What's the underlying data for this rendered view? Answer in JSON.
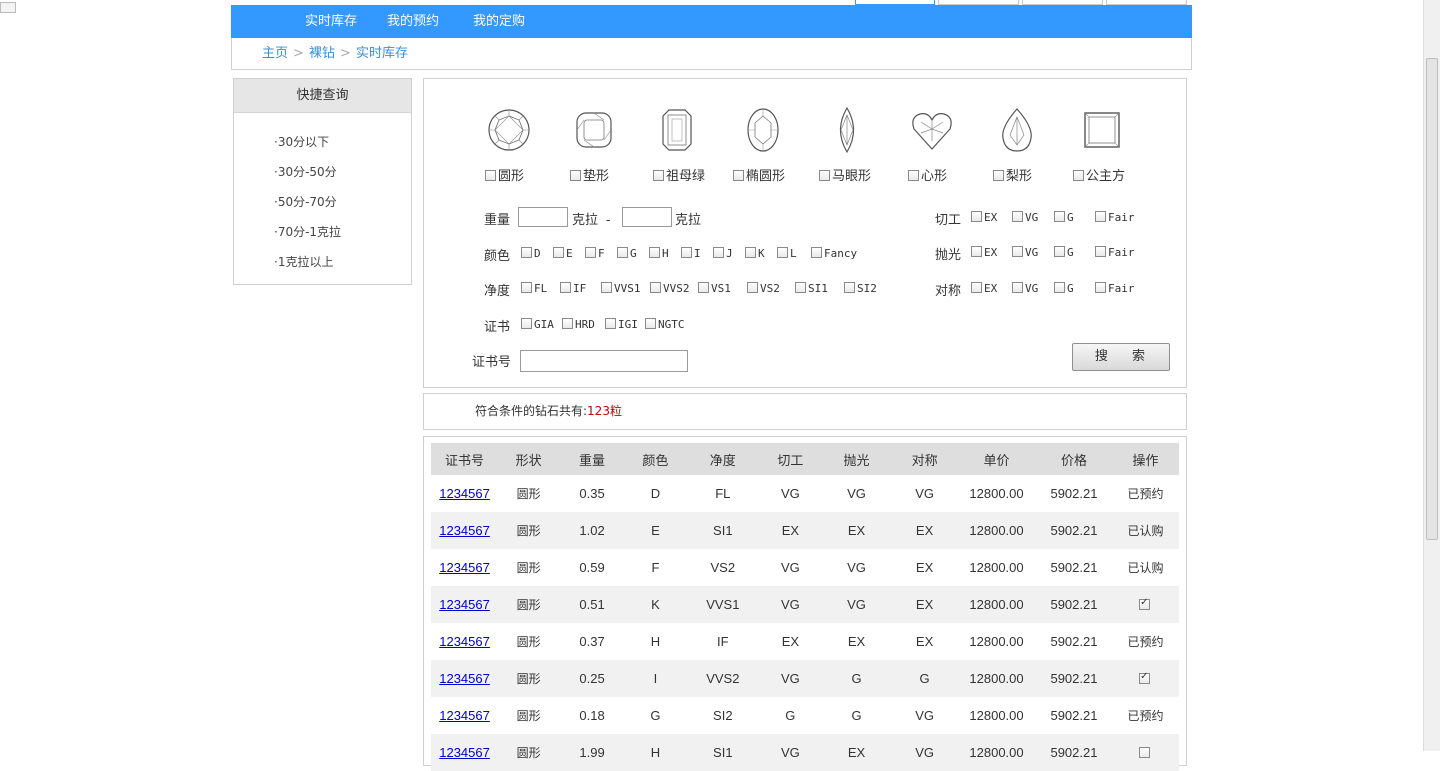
{
  "nav": {
    "tabs": [
      "实时库存",
      "我的预约",
      "我的定购"
    ]
  },
  "breadcrumb": [
    "主页",
    "裸钻",
    "实时库存"
  ],
  "sidebar": {
    "title": "快捷查询",
    "items": [
      "·30分以下",
      "·30分-50分",
      "·50分-70分",
      "·70分-1克拉",
      "·1克拉以上"
    ]
  },
  "shapes": [
    "圆形",
    "垫形",
    "祖母绿",
    "椭圆形",
    "马眼形",
    "心形",
    "梨形",
    "公主方"
  ],
  "filters": {
    "weight_label": "重量",
    "unit": "克拉",
    "dash": "-",
    "color_label": "颜色",
    "color_options": [
      "D",
      "E",
      "F",
      "G",
      "H",
      "I",
      "J",
      "K",
      "L",
      "Fancy"
    ],
    "clarity_label": "净度",
    "clarity_options": [
      "FL",
      "IF",
      "VVS1",
      "VVS2",
      "VS1",
      "VS2",
      "SI1",
      "SI2"
    ],
    "cert_label": "证书",
    "cert_options": [
      "GIA",
      "HRD",
      "IGI",
      "NGTC"
    ],
    "cert_no_label": "证书号",
    "cut_label": "切工",
    "polish_label": "抛光",
    "symmetry_label": "对称",
    "grade_options": [
      "EX",
      "VG",
      "G",
      "Fair"
    ],
    "search_label": "搜 索"
  },
  "count": {
    "prefix": "符合条件的钻石共有:",
    "value": "123粒"
  },
  "table": {
    "headers": [
      "证书号",
      "形状",
      "重量",
      "颜色",
      "净度",
      "切工",
      "抛光",
      "对称",
      "单价",
      "价格",
      "操作"
    ],
    "rows": [
      [
        "1234567",
        "圆形",
        "0.35",
        "D",
        "FL",
        "VG",
        "VG",
        "VG",
        "12800.00",
        "5902.21",
        "已预约"
      ],
      [
        "1234567",
        "圆形",
        "1.02",
        "E",
        "SI1",
        "EX",
        "EX",
        "EX",
        "12800.00",
        "5902.21",
        "已认购"
      ],
      [
        "1234567",
        "圆形",
        "0.59",
        "F",
        "VS2",
        "VG",
        "VG",
        "EX",
        "12800.00",
        "5902.21",
        "已认购"
      ],
      [
        "1234567",
        "圆形",
        "0.51",
        "K",
        "VVS1",
        "VG",
        "VG",
        "EX",
        "12800.00",
        "5902.21",
        "checked"
      ],
      [
        "1234567",
        "圆形",
        "0.37",
        "H",
        "IF",
        "EX",
        "EX",
        "EX",
        "12800.00",
        "5902.21",
        "已预约"
      ],
      [
        "1234567",
        "圆形",
        "0.25",
        "I",
        "VVS2",
        "VG",
        "G",
        "G",
        "12800.00",
        "5902.21",
        "checked"
      ],
      [
        "1234567",
        "圆形",
        "0.18",
        "G",
        "SI2",
        "G",
        "G",
        "VG",
        "12800.00",
        "5902.21",
        "已预约"
      ],
      [
        "1234567",
        "圆形",
        "1.99",
        "H",
        "SI1",
        "VG",
        "EX",
        "VG",
        "12800.00",
        "5902.21",
        "unchecked"
      ]
    ]
  },
  "colors": {
    "nav_bg": "#3399ff",
    "link": "#0000cc",
    "breadcrumb": "#3a8fd8",
    "count": "#cc0000"
  }
}
